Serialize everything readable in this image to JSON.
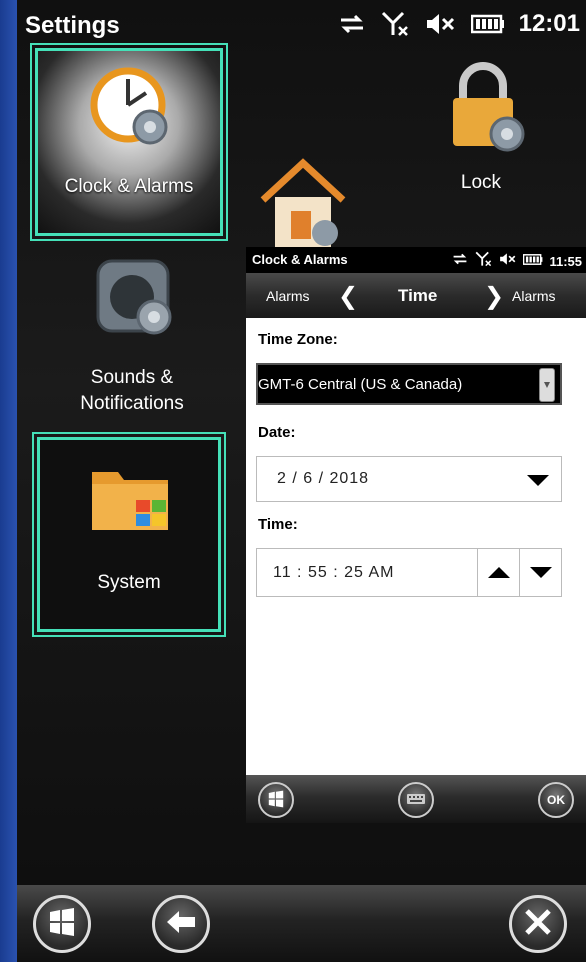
{
  "main": {
    "title": "Settings",
    "status_time": "12:01",
    "tiles": {
      "clock": "Clock & Alarms",
      "lock": "Lock",
      "sounds": "Sounds & Notifications",
      "system": "System"
    },
    "highlight_color": "#45e0b8"
  },
  "overlay": {
    "title": "Clock & Alarms",
    "status_time": "11:55",
    "nav": {
      "prev": "Alarms",
      "current": "Time",
      "next": "Alarms"
    },
    "time_zone_label": "Time Zone:",
    "time_zone_value": "GMT-6 Central (US & Canada)",
    "date_label": "Date:",
    "date_value": "2  /  6  / 2018",
    "time_label": "Time:",
    "time_value": "11  :  55  :  25    AM",
    "ok_label": "OK"
  },
  "icons": {
    "status": [
      "network-sync-icon",
      "no-signal-icon",
      "mute-icon",
      "battery-icon"
    ],
    "bottom": [
      "windows-start-icon",
      "back-arrow-icon",
      "close-icon"
    ],
    "overlay_bottom": [
      "windows-start-icon",
      "keyboard-icon",
      "ok-icon"
    ]
  }
}
